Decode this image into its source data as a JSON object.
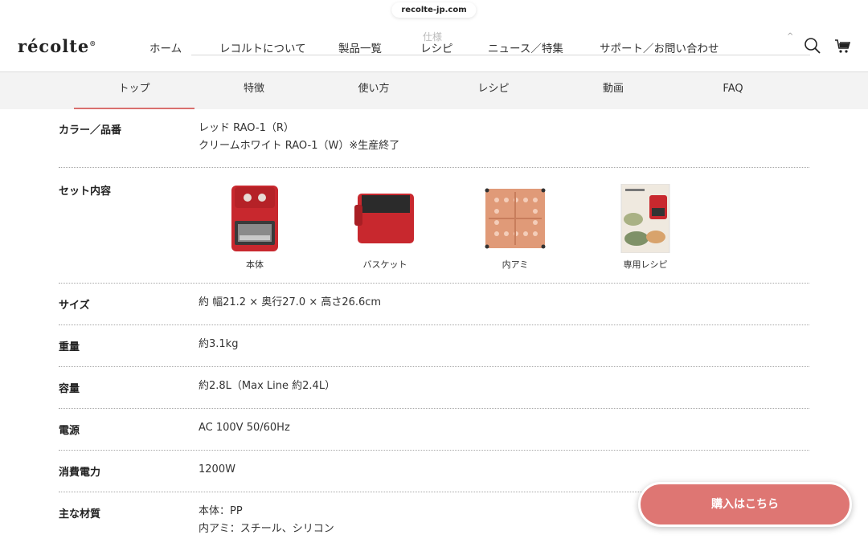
{
  "browser": {
    "url": "recolte-jp.com"
  },
  "header": {
    "logo": "récolte",
    "nav": [
      "ホーム",
      "レコルトについて",
      "製品一覧",
      "レシピ",
      "ニュース／特集",
      "サポート／お問い合わせ"
    ],
    "ghost_label": "仕様",
    "icons": {
      "search": "search-icon",
      "cart": "cart-icon",
      "caret": "chevron-up-icon"
    }
  },
  "subnav": {
    "tabs": [
      "トップ",
      "特徴",
      "使い方",
      "レシピ",
      "動画",
      "FAQ"
    ],
    "active": "トップ"
  },
  "spec": {
    "color": {
      "label": "カラー／品番",
      "lines": [
        "レッド RAO-1（R）",
        "クリームホワイト RAO-1（W）※生産終了"
      ]
    },
    "set": {
      "label": "セット内容",
      "items": [
        "本体",
        "バスケット",
        "内アミ",
        "専用レシピ"
      ]
    },
    "size": {
      "label": "サイズ",
      "value": "約 幅21.2 × 奥行27.0 × 高さ26.6cm"
    },
    "weight": {
      "label": "重量",
      "value": "約3.1kg"
    },
    "capacity": {
      "label": "容量",
      "value": "約2.8L（Max Line 約2.4L）"
    },
    "power": {
      "label": "電源",
      "value": "AC 100V 50/60Hz"
    },
    "consumption": {
      "label": "消費電力",
      "value": "1200W"
    },
    "material": {
      "label": "主な材質",
      "lines": [
        "本体：PP",
        "内アミ：スチール、シリコン"
      ]
    }
  },
  "buy_button": {
    "label": "購入はこちら"
  },
  "colors": {
    "accent": "#de7673",
    "product_red": "#c8282e",
    "tab_underline": "#d9706e"
  }
}
